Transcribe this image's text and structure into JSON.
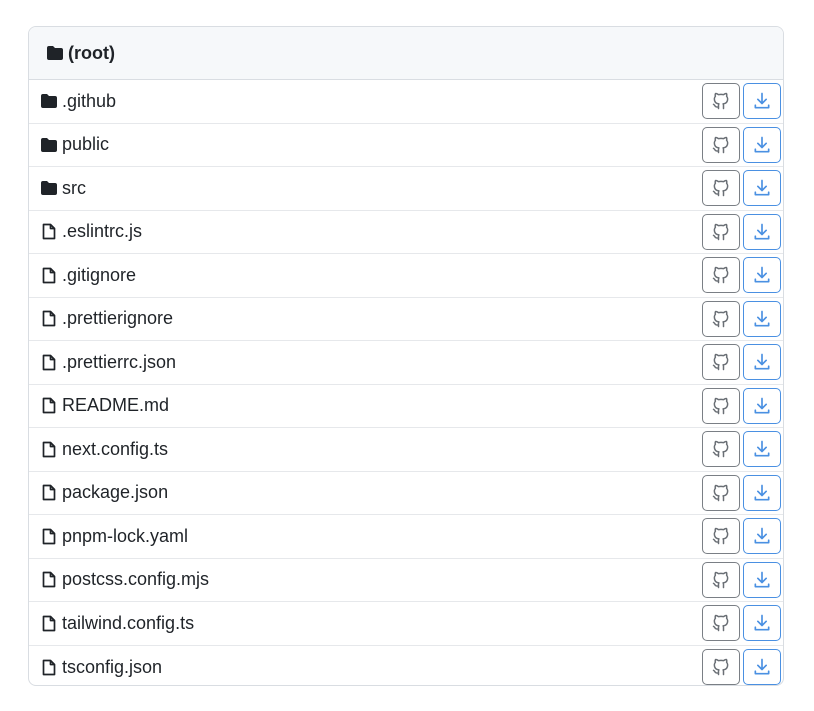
{
  "root": {
    "label": "(root)",
    "icon": "folder-icon"
  },
  "items": [
    {
      "name": ".github",
      "type": "folder"
    },
    {
      "name": "public",
      "type": "folder"
    },
    {
      "name": "src",
      "type": "folder"
    },
    {
      "name": ".eslintrc.js",
      "type": "file"
    },
    {
      "name": ".gitignore",
      "type": "file"
    },
    {
      "name": ".prettierignore",
      "type": "file"
    },
    {
      "name": ".prettierrc.json",
      "type": "file"
    },
    {
      "name": "README.md",
      "type": "file"
    },
    {
      "name": "next.config.ts",
      "type": "file"
    },
    {
      "name": "package.json",
      "type": "file"
    },
    {
      "name": "pnpm-lock.yaml",
      "type": "file"
    },
    {
      "name": "postcss.config.mjs",
      "type": "file"
    },
    {
      "name": "tailwind.config.ts",
      "type": "file"
    },
    {
      "name": "tsconfig.json",
      "type": "file"
    }
  ],
  "actions": {
    "github_icon": "github-icon",
    "download_icon": "download-icon"
  },
  "colors": {
    "download_accent": "#4a90e2",
    "github_border": "#7a7f85",
    "header_bg": "#f6f8fa"
  }
}
